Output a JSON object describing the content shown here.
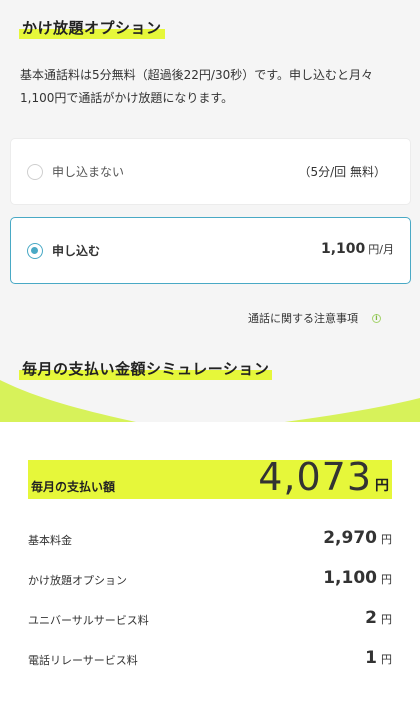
{
  "option_section": {
    "title": "かけ放題オプション",
    "description": "基本通話料は5分無料（超過後22円/30秒）です。申し込むと月々1,100円で通話がかけ放題になります。",
    "options": [
      {
        "label": "申し込まない",
        "right_text": "（5分/回 無料）",
        "selected": false
      },
      {
        "label": "申し込む",
        "price": "1,100",
        "unit": "円/月",
        "selected": true
      }
    ],
    "notes_link": "通話に関する注意事項",
    "notes_icon": "info-icon"
  },
  "simulation_section": {
    "title": "毎月の支払い金額シミュレーション",
    "total": {
      "label": "毎月の支払い額",
      "value": "4,073",
      "unit": "円"
    },
    "rows": [
      {
        "label": "基本料金",
        "value": "2,970",
        "unit": "円"
      },
      {
        "label": "かけ放題オプション",
        "value": "1,100",
        "unit": "円"
      },
      {
        "label": "ユニバーサルサービス料",
        "value": "2",
        "unit": "円"
      },
      {
        "label": "電話リレーサービス料",
        "value": "1",
        "unit": "円"
      }
    ]
  },
  "colors": {
    "highlight": "#e6f73a",
    "accent": "#49a9c5",
    "wave": "#d7f25a",
    "background": "#f5f5f5"
  }
}
